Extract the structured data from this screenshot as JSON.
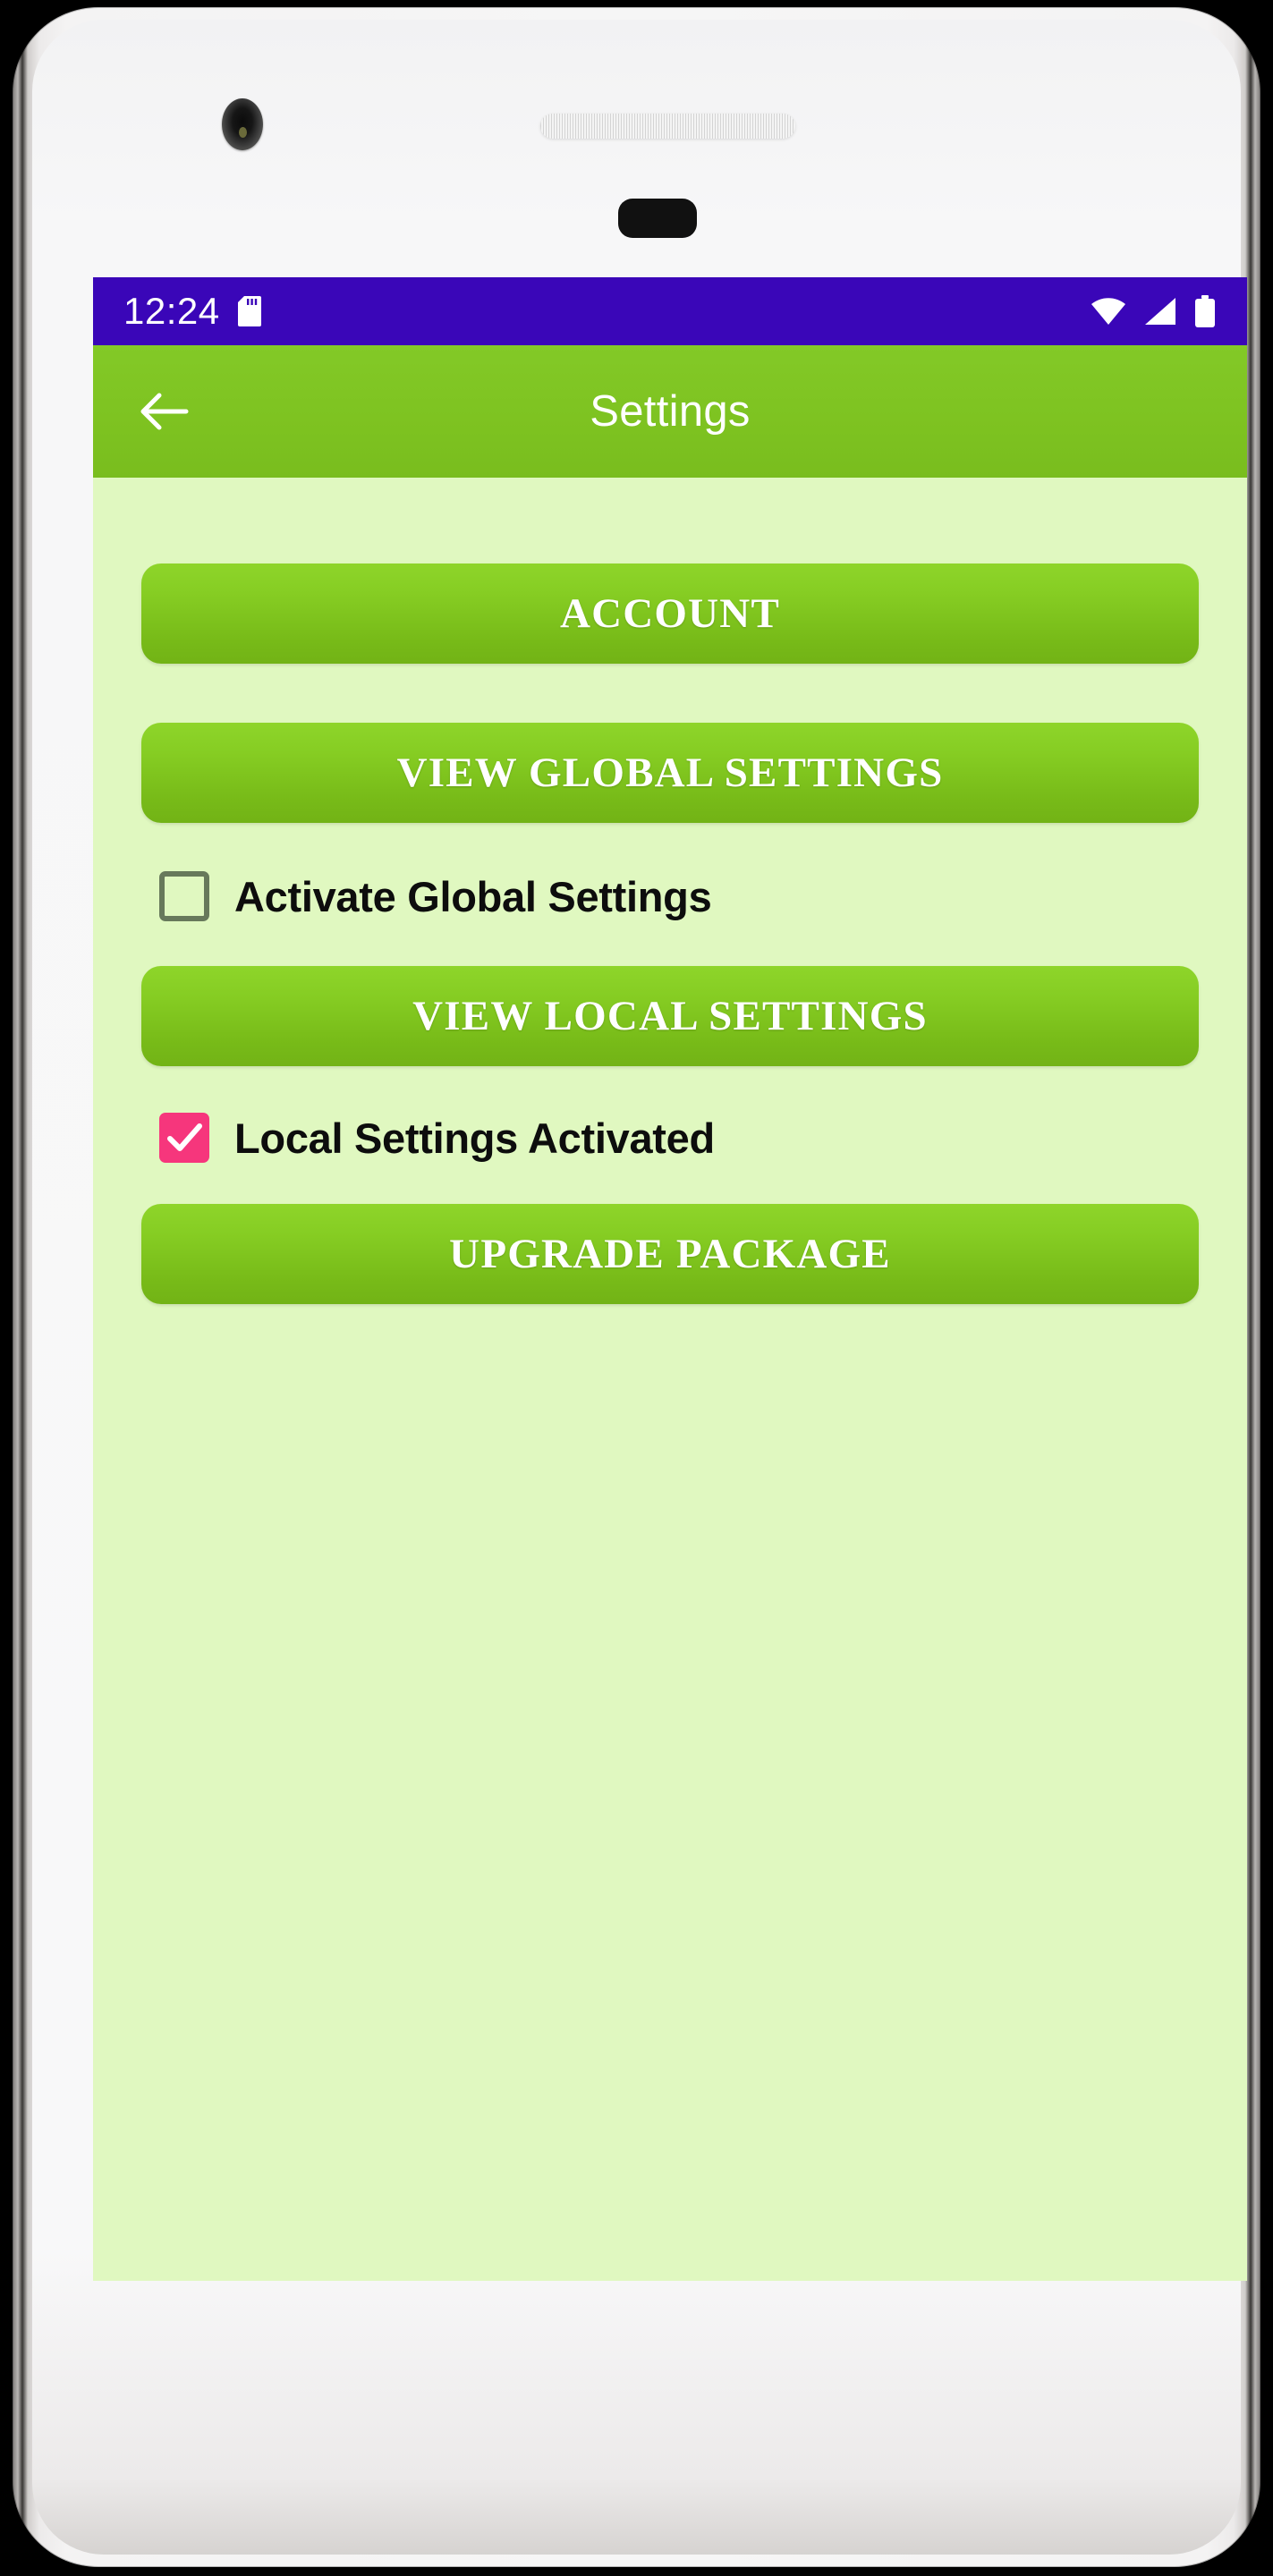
{
  "statusbar": {
    "time": "12:24",
    "icons": [
      "sdcard-icon",
      "wifi-icon",
      "signal-icon",
      "battery-icon"
    ]
  },
  "appbar": {
    "title": "Settings",
    "back_icon": "back-arrow-icon",
    "bg_color": "#7DC41E"
  },
  "screen": {
    "bg_color": "#E0F8C0"
  },
  "colors": {
    "status_purple": "#3A06B8",
    "button_green_top": "#8ED52A",
    "button_green_bottom": "#72B316",
    "checkbox_checked": "#F6367C",
    "checkbox_unchecked_border": "#67795B"
  },
  "main": {
    "account_button": "ACCOUNT",
    "view_global_settings_button": "VIEW GLOBAL SETTINGS",
    "activate_global_settings_label": "Activate Global Settings",
    "activate_global_settings_checked": "false",
    "view_local_settings_button": "VIEW LOCAL SETTINGS",
    "local_settings_activated_label": "Local Settings Activated",
    "local_settings_activated_checked": "true",
    "upgrade_package_button": "UPGRADE PACKAGE"
  },
  "navbar": {
    "home_indicator": "home-pill"
  }
}
